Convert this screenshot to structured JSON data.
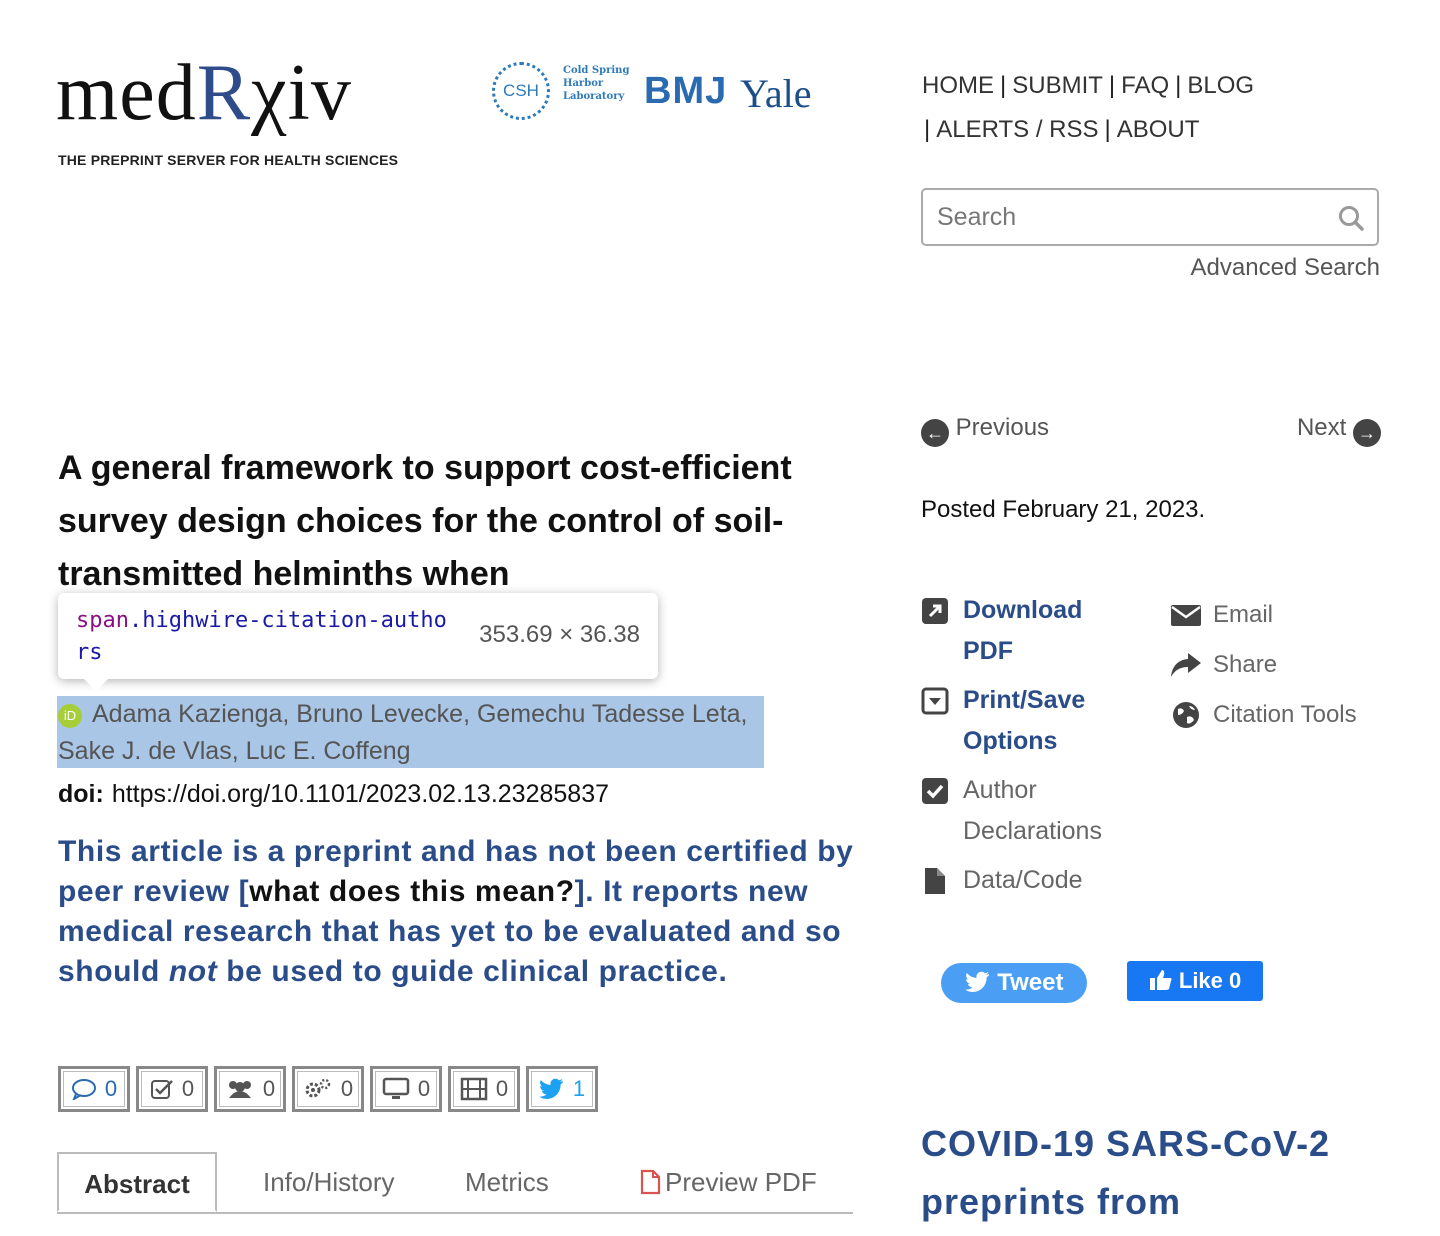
{
  "header": {
    "logo_prefix": "med",
    "logo_r": "R",
    "logo_suffix": "χiv",
    "tagline": "THE PREPRINT SERVER FOR HEALTH SCIENCES",
    "partners": {
      "csh_short": "CSH",
      "csh_full": "Cold Spring Harbor Laboratory",
      "bmj": "BMJ",
      "yale": "Yale"
    },
    "nav": [
      "HOME",
      "SUBMIT",
      "FAQ",
      "BLOG",
      "ALERTS / RSS",
      "ABOUT"
    ],
    "search_placeholder": "Search",
    "advanced_search": "Advanced Search"
  },
  "article": {
    "title": "A general framework to support cost-efficient survey design choices for the control of soil-transmitted helminths when",
    "authors_line1": "Adama Kazienga, Bruno Levecke, Gemechu Tadesse Leta,",
    "authors_line2": "Sake J. de Vlas, Luc E. Coffeng",
    "doi_label": "doi:",
    "doi_value": "https://doi.org/10.1101/2023.02.13.23285837",
    "note_part1": "This article is a preprint and has not been certified by peer review [",
    "note_link": "what does this mean?",
    "note_part2": "]. It reports new medical research that has yet to be evaluated and so should ",
    "note_not": "not",
    "note_part3": " be used to guide clinical practice."
  },
  "devtools_tooltip": {
    "tag": "span",
    "class": ".highwire-citation-authors",
    "dimensions": "353.69 × 36.38"
  },
  "metrics": [
    {
      "icon": "comment-icon",
      "count": "0"
    },
    {
      "icon": "checkbox-icon",
      "count": "0"
    },
    {
      "icon": "users-icon",
      "count": "0"
    },
    {
      "icon": "gears-icon",
      "count": "0"
    },
    {
      "icon": "monitor-icon",
      "count": "0"
    },
    {
      "icon": "film-icon",
      "count": "0"
    },
    {
      "icon": "twitter-icon",
      "count": "1"
    }
  ],
  "tabs": {
    "abstract": "Abstract",
    "info": "Info/History",
    "metrics": "Metrics",
    "preview_pdf": "Preview PDF"
  },
  "sidebar": {
    "previous": "Previous",
    "next": "Next",
    "posted": "Posted February 21, 2023.",
    "download_pdf": "Download PDF",
    "print_save": "Print/Save Options",
    "author_declarations": "Author Declarations",
    "data_code": "Data/Code",
    "email": "Email",
    "share": "Share",
    "citation_tools": "Citation Tools",
    "tweet": "Tweet",
    "like": "Like 0",
    "covid_heading": "COVID-19 SARS-CoV-2 preprints from"
  },
  "colors": {
    "brand_blue": "#2a4d8a",
    "highlight": "#a9c6e6",
    "twitter": "#4a9ff5",
    "facebook": "#1877f2"
  }
}
